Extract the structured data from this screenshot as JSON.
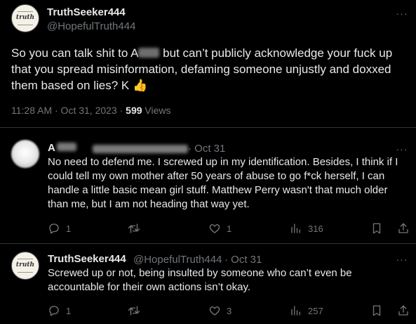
{
  "main_post": {
    "avatar_text": "truth",
    "display_name": "TruthSeeker444",
    "handle": "@HopefulTruth444",
    "text_part1": "So you can talk shit to A",
    "text_part2": " but can’t publicly acknowledge your fuck up that you spread misinformation, defaming someone unjustly and doxxed them based on lies? K ",
    "emoji": "👍",
    "timestamp": "11:28 AM · Oct 31, 2023 · ",
    "views_count": "599",
    "views_label": " Views"
  },
  "replies": [
    {
      "display_name": "A",
      "date": " · Oct 31",
      "text": "No need to defend me.  I screwed up in my identification. Besides, I think if I could tell my own mother after 50 years of abuse to go f*ck herself,  I can handle a little basic mean girl stuff. Matthew Perry wasn't that much older than me, but I am not heading that way yet.",
      "reply_count": "1",
      "repost_count": "",
      "like_count": "1",
      "view_count": "316"
    },
    {
      "avatar_text": "truth",
      "display_name": "TruthSeeker444",
      "handle": "@HopefulTruth444",
      "date": " · Oct 31",
      "text": "Screwed up or not, being insulted by someone who can’t even be accountable for their own actions isn’t okay.",
      "reply_count": "1",
      "repost_count": "",
      "like_count": "3",
      "view_count": "257"
    }
  ],
  "icons": [
    "more-icon",
    "reply-icon",
    "repost-icon",
    "like-icon",
    "views-icon",
    "bookmark-icon",
    "share-icon"
  ],
  "colors": {
    "background": "#000000",
    "text": "#e7e9ea",
    "muted": "#71767b",
    "divider": "#2f3336"
  }
}
